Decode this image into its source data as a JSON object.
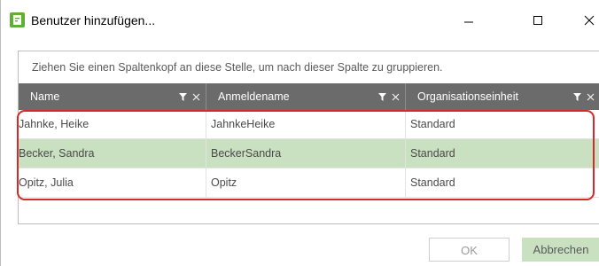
{
  "window": {
    "title": "Benutzer hinzufügen...",
    "controls": {
      "minimize": "minimize-icon",
      "maximize": "maximize-icon",
      "close": "close-icon"
    }
  },
  "grid": {
    "group_hint": "Ziehen Sie einen Spaltenkopf an diese Stelle, um nach dieser Spalte zu gruppieren.",
    "columns": [
      {
        "label": "Name"
      },
      {
        "label": "Anmeldename"
      },
      {
        "label": "Organisationseinheit"
      }
    ],
    "rows": [
      {
        "name": "Jahnke, Heike",
        "login": "JahnkeHeike",
        "unit": "Standard",
        "highlighted": false
      },
      {
        "name": "Becker, Sandra",
        "login": "BeckerSandra",
        "unit": "Standard",
        "highlighted": true
      },
      {
        "name": "Opitz, Julia",
        "login": "Opitz",
        "unit": "Standard",
        "highlighted": false
      }
    ]
  },
  "buttons": {
    "ok_label": "OK",
    "cancel_label": "Abbrechen"
  },
  "colors": {
    "header_bg": "#6b6b6b",
    "selected_row_bg": "#c9e0c1",
    "highlight_border": "#d42a2a",
    "app_icon": "#5fae36"
  }
}
